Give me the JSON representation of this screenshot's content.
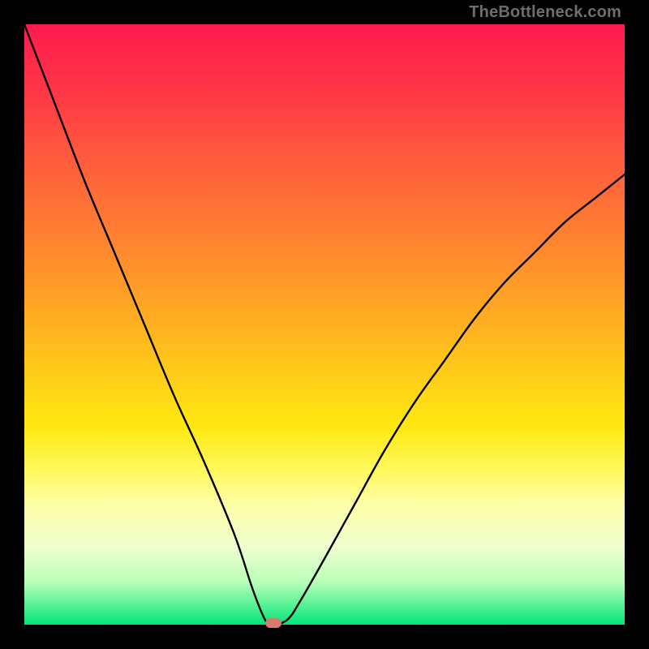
{
  "watermark": "TheBottleneck.com",
  "chart_data": {
    "type": "line",
    "title": "",
    "xlabel": "",
    "ylabel": "",
    "xlim": [
      0,
      100
    ],
    "ylim": [
      0,
      100
    ],
    "grid": false,
    "legend": false,
    "series": [
      {
        "name": "bottleneck-curve",
        "x": [
          0,
          5,
          10,
          15,
          20,
          25,
          30,
          35,
          38,
          40,
          41,
          42,
          44,
          46,
          50,
          55,
          60,
          65,
          70,
          75,
          80,
          85,
          90,
          95,
          100
        ],
        "values": [
          100,
          87,
          74,
          62,
          50,
          38,
          27,
          15,
          6,
          1,
          0,
          0,
          1,
          4,
          11,
          20,
          29,
          37,
          44,
          51,
          57,
          62,
          67,
          71,
          75
        ]
      }
    ],
    "minimum_marker": {
      "x": 41.5,
      "y": 0
    },
    "background_gradient": {
      "top": "#ff1a4d",
      "mid": "#ffe810",
      "bottom": "#00e676"
    },
    "curve_color": "#000000",
    "marker_color": "#d87a6f"
  }
}
